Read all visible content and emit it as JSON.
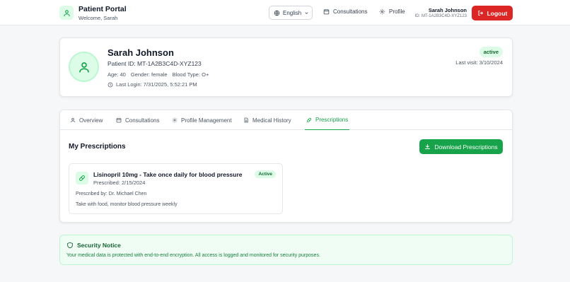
{
  "header": {
    "app_title": "Patient Portal",
    "welcome": "Welcome, Sarah",
    "language": "English",
    "nav": {
      "consultations": "Consultations",
      "profile": "Profile"
    },
    "user_name": "Sarah Johnson",
    "user_id": "ID: MT-1A2B3C4D-XYZ123",
    "logout_label": "Logout"
  },
  "patient": {
    "name": "Sarah Johnson",
    "id_line": "Patient ID: MT-1A2B3C4D-XYZ123",
    "age": "Age: 40",
    "gender": "Gender: female",
    "blood_type": "Blood Type: O+",
    "last_login": "Last Login: 7/31/2025, 5:52:21 PM",
    "status": "active",
    "last_visit": "Last visit: 3/10/2024"
  },
  "tabs": {
    "overview": "Overview",
    "consultations": "Consultations",
    "profile_management": "Profile Management",
    "medical_history": "Medical History",
    "prescriptions": "Prescriptions"
  },
  "prescriptions": {
    "section_title": "My Prescriptions",
    "download_label": "Download Prescriptions",
    "items": [
      {
        "title": "Lisinopril 10mg - Take once daily for blood pressure",
        "prescribed": "Prescribed: 2/15/2024",
        "status": "Active",
        "prescribed_by": "Prescribed by: Dr. Michael Chen",
        "note": "Take with food, monitor blood pressure weekly"
      }
    ]
  },
  "security_notice": {
    "title": "Security Notice",
    "text": "Your medical data is protected with end-to-end encryption. All access is logged and monitored for security purposes."
  },
  "colors": {
    "accent": "#16a34a",
    "danger": "#dc2626",
    "badge_bg": "#dcfce7"
  }
}
